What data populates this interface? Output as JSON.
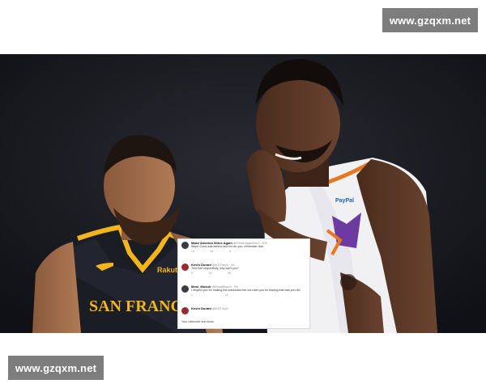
{
  "watermarks": {
    "top": "www.gzqxm.net",
    "bottom": "www.gzqxm.net"
  },
  "photo": {
    "jersey_left_text": "SAN FRANCISC",
    "jersey_left_sponsor": "Rakuten",
    "jersey_right_sponsor": "PayPal"
  },
  "tweets": [
    {
      "name": "Make America Shine Again",
      "handle": "@ShineAgainDev · 10h",
      "text": "Steph Curry was behind and he ran you. remember that",
      "stats": [
        "12",
        "1k",
        "9"
      ]
    },
    {
      "name": "Kevin Durant",
      "handle": "@KDTrey5 · 6h",
      "text": "Thirl Daf' respectfully, why can't you?",
      "stats": [
        "4",
        "1k",
        "5k"
      ]
    },
    {
      "name": "Mosi_Mosoh",
      "handle": "@MosiMosoh · 5h",
      "text": "I respect you for making the unfounded fan out rules you for leaving that was you did",
      "stats": [
        "3",
        "",
        "1k"
      ]
    },
    {
      "name": "Kevin Durant",
      "handle": "@KDTrey5",
      "text": "",
      "stats": []
    }
  ],
  "tweet_footer": "Your visitounte and show"
}
